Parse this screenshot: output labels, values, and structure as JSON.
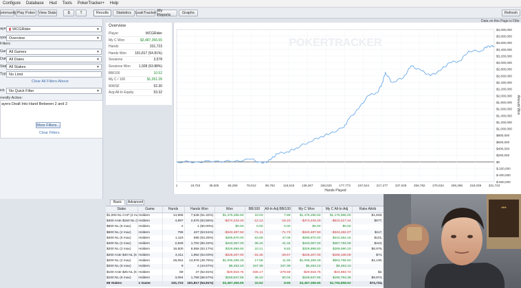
{
  "menu": [
    "Configure",
    "Database",
    "Hud",
    "Tools",
    "PokerTracker+",
    "Help"
  ],
  "toolbar": {
    "buttons": [
      "Community",
      "Play Poker",
      "View Stats",
      "$",
      "T",
      "Results",
      "Statistics",
      "LeakTracker",
      "My Reports",
      "Graphs"
    ],
    "refresh": "Refresh",
    "filter_info": "Data on this Page is Filte"
  },
  "left": {
    "player_label": "ayer",
    "player_value": "WCGRider",
    "report_label": "rport",
    "report_value": "Overview",
    "filters_title": "Filters",
    "rows": [
      {
        "label": "Game",
        "value": "All Games"
      },
      {
        "label": "Date",
        "value": "All Dates"
      },
      {
        "label": "Stake",
        "value": "All Stakes"
      },
      {
        "label": "Type",
        "value": "No Limit"
      }
    ],
    "clear_all": "Clear All Filters Above",
    "quick_label": "ick",
    "quick_value": "No Quick Filter",
    "active_title": "rrently Active:",
    "active_text": "ayers Dealt Into Hand Between 2 and 2",
    "more_filters": "More Filters...",
    "clear_filters": "Clear Filters"
  },
  "overview": {
    "title": "Overview",
    "rows": [
      {
        "label": "Player",
        "value": "WCGRider",
        "green": false
      },
      {
        "label": "My C Won",
        "value": "$3,487,356.65",
        "green": true
      },
      {
        "label": "Hands",
        "value": "331,723",
        "green": false
      },
      {
        "label": "Hands Won",
        "value": "181,817 (54.81%)",
        "green": false
      },
      {
        "label": "Sessions",
        "value": "3,578",
        "green": false
      },
      {
        "label": "Sessions Won",
        "value": "1,928 (53.88%)",
        "green": false
      },
      {
        "label": "BB/100",
        "value": "10.52",
        "green": true
      },
      {
        "label": "My C / 100",
        "value": "$1,051.28",
        "green": true
      },
      {
        "label": "WWSF",
        "value": "52.30",
        "green": false
      },
      {
        "label": "Avg All-In Equity",
        "value": "53.32",
        "green": false
      }
    ]
  },
  "chart_data": {
    "type": "line",
    "watermark": "POKERTRACKER",
    "xlabel": "Hands Played",
    "ylabel": "Amount Won",
    "x_ticks": [
      "1",
      "19,753",
      "38,505",
      "58,258",
      "78,012",
      "98,762",
      "116,515",
      "138,267",
      "158,020",
      "177,773",
      "197,524",
      "217,277",
      "237,028",
      "256,782",
      "276,534",
      "296,286",
      "318,039",
      "331,723"
    ],
    "y_ticks": [
      "$4,000,000",
      "$3,800,000",
      "$3,600,000",
      "$3,400,000",
      "$3,200,000",
      "$3,000,000",
      "$2,800,000",
      "$2,600,000",
      "$2,400,000",
      "$2,200,000",
      "$2,000,000",
      "$1,800,000",
      "$1,600,000",
      "$1,400,000",
      "$1,200,000",
      "$1,000,000",
      "$800,000",
      "$600,000",
      "$400,000",
      "$200,000",
      "$0",
      "$-200,000",
      "$-400,000",
      "$-600,000"
    ],
    "ylim": [
      -600000,
      4000000
    ],
    "xlim": [
      1,
      331723
    ],
    "grid": true,
    "series": [
      {
        "color": "#6aa9e8",
        "x": [
          1,
          20000,
          40000,
          60000,
          78000,
          90000,
          98000,
          105000,
          116000,
          125000,
          138000,
          150000,
          160000,
          175000,
          180000,
          190000,
          200000,
          210000,
          215000,
          218000,
          225000,
          237000,
          245000,
          256000,
          265000,
          275000,
          285000,
          296000,
          305000,
          318000,
          325000,
          331723
        ],
        "y": [
          0,
          0,
          20000,
          10000,
          80000,
          -50000,
          60000,
          250000,
          300000,
          420000,
          600000,
          750000,
          850000,
          1050000,
          1300000,
          1600000,
          2000000,
          2100000,
          2400000,
          2700000,
          2400000,
          2550000,
          2900000,
          2750000,
          2600000,
          2750000,
          3000000,
          3050000,
          3350000,
          3350000,
          3500000,
          3487356
        ]
      }
    ]
  },
  "table": {
    "tabs": [
      "Basic",
      "Advanced"
    ],
    "headers": [
      "Stake",
      "Game",
      "Hands",
      "Hands Won",
      "Won",
      "BB/100",
      "All-In Adj BB/100",
      "My C Won",
      "My C All-In Adj",
      "Rake Attrib"
    ],
    "rows": [
      [
        "$1,000 NL CAP (2 max)",
        "Holdem",
        "14,996",
        "7,546 (51.32%)",
        "$1,475,285.50",
        "10.03",
        "7.89",
        "$1,475,285.50",
        "$1,175,965.00",
        "$1,849,"
      ],
      [
        "$400 Ante $150 NL (6 max)",
        "Holdem",
        "4,997",
        "2,676 (53.55%)",
        "-$474,243.40",
        "-12.13",
        "-15.23",
        "-$474,243.40",
        "-$510,217.44",
        "$577,"
      ],
      [
        "$600 NL (6 max)",
        "Holdem",
        "2",
        "1 (50.00%)",
        "$0.00",
        "0.00",
        "0.00",
        "$0.00",
        "$0.00",
        ""
      ],
      [
        "$600 NL (2 max)",
        "Holdem",
        "798",
        "427 (53.51%)",
        "-$340,487.50",
        "-71.11",
        "-71.73",
        "-$340,487.50",
        "-$343,492.07",
        "$117,"
      ],
      [
        "$400 NL (6 max)",
        "Holdem",
        "1,119",
        "596 (53.26%)",
        "$285,870.00",
        "63.69",
        "47.08",
        "$285,870.00",
        "$210,364.15",
        "$101,"
      ],
      [
        "$400 NL (2 max)",
        "Holdem",
        "2,828",
        "1,702 (60.22%)",
        "$440,057.00",
        "38.15",
        "41.34",
        "$440,057.00",
        "$467,784.09",
        "$443,"
      ],
      [
        "$200 NL (2 max)",
        "Holdem",
        "16,500",
        "8,556 (53.17%)",
        "$328,898.60",
        "10.21",
        "8.82",
        "$328,898.60",
        "$289,990.20",
        "$8,976,"
      ],
      [
        "$200 Ante $40 NL (6 max)",
        "Holdem",
        "3,311",
        "1,962 (54.03%)",
        "-$228,207.00",
        "-34.45",
        "-28.57",
        "-$228,207.00",
        "-$189,108.09",
        "$74,"
      ],
      [
        "$200 NL (2 max)",
        "Holdem",
        "28,054",
        "13,978 (49.78%)",
        "$1,006,269.49",
        "17.58",
        "11.55",
        "$1,006,269.49",
        "$663,755.50",
        "$4,130,"
      ],
      [
        "$200 NL (6 max)",
        "Holdem",
        "9",
        "4 (44.67%)",
        "$6,253.10",
        "347.39",
        "347.39",
        "$6,253.10",
        "$6,253.10",
        ""
      ],
      [
        "$100 Ante $25 NL (6 max)",
        "Holdem",
        "89",
        "47 (52.81%)",
        "-$29,918.75",
        "-336.17",
        "-279.59",
        "-$29,918.75",
        "-$24,883.72",
        "$2,"
      ],
      [
        "$100 NL (6 max)",
        "Holdem",
        "3,094",
        "1,759 (56.57%)",
        "$159,847.65",
        "45.10",
        "50.04",
        "$159,847.65",
        "$190,794.36",
        "$9,974,"
      ]
    ],
    "total": [
      "68 Stakes",
      "1 Game",
      "331,723",
      "181,817 (54.81%)",
      "$3,487,356.65",
      "10.52",
      "8.65",
      "$3,487,356.65",
      "$2,755,858.62",
      "$74,734,"
    ]
  },
  "colors": {
    "accent": "#4a78c2",
    "positive": "#178a2a",
    "negative": "#c62828",
    "line": "#6aa9e8"
  }
}
